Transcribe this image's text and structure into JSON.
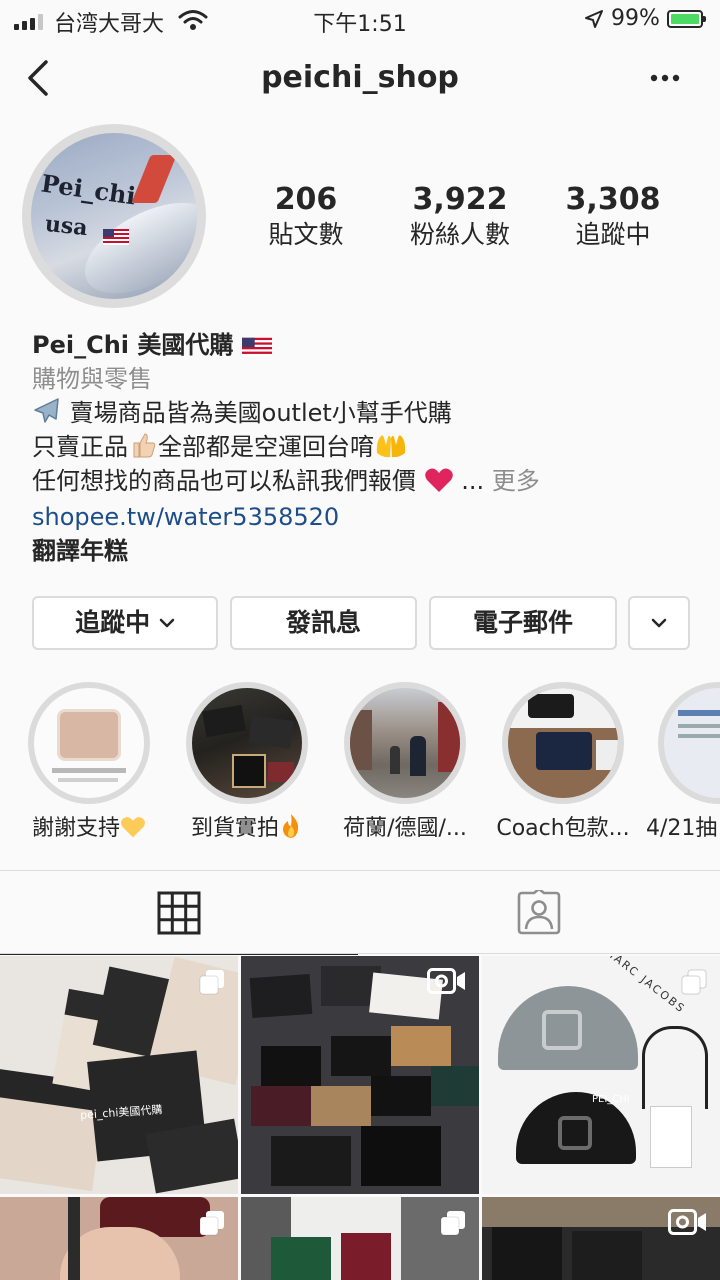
{
  "status_bar": {
    "carrier": "台湾大哥大",
    "time": "下午1:51",
    "battery": "99%"
  },
  "nav": {
    "username": "peichi_shop"
  },
  "profile": {
    "avatar_text_1": "Pei_chi",
    "avatar_text_2": "usa",
    "stats": [
      {
        "value": "206",
        "label": "貼文數"
      },
      {
        "value": "3,922",
        "label": "粉絲人數"
      },
      {
        "value": "3,308",
        "label": "追蹤中"
      }
    ]
  },
  "bio": {
    "name": "Pei_Chi 美國代購",
    "category": "購物與零售",
    "line1": "賣場商品皆為美國outlet小幫手代購",
    "line2a": "只賣正品",
    "line2b": "全部都是空運回台唷",
    "line3": "任何想找的商品也可以私訊我們報價",
    "ellipsis": "...",
    "more": "更多",
    "link": "shopee.tw/water5358520",
    "translate": "翻譯年糕"
  },
  "buttons": {
    "following": "追蹤中",
    "message": "發訊息",
    "email": "電子郵件"
  },
  "highlights": [
    {
      "label": "謝謝支持"
    },
    {
      "label": "到貨實拍"
    },
    {
      "label": "荷蘭/德國/..."
    },
    {
      "label": "Coach包款..."
    },
    {
      "label": "4/21抽"
    }
  ],
  "posts": {
    "p1_watermark": "pei_chi美國代購",
    "p3_brand": "MARC JACOBS",
    "p3_watermark": "PEI_CHI"
  },
  "colors": {
    "link": "#1d4e89",
    "secondary_text": "#8e8e8e",
    "border": "#dbdbdb",
    "heart": "#e0245e",
    "battery_fill": "#4cd964"
  },
  "icons": [
    "back-chevron-icon",
    "more-dots-icon",
    "grid-icon",
    "tagged-person-icon",
    "carousel-icon",
    "video-icon",
    "wifi-icon",
    "location-arrow-icon"
  ]
}
